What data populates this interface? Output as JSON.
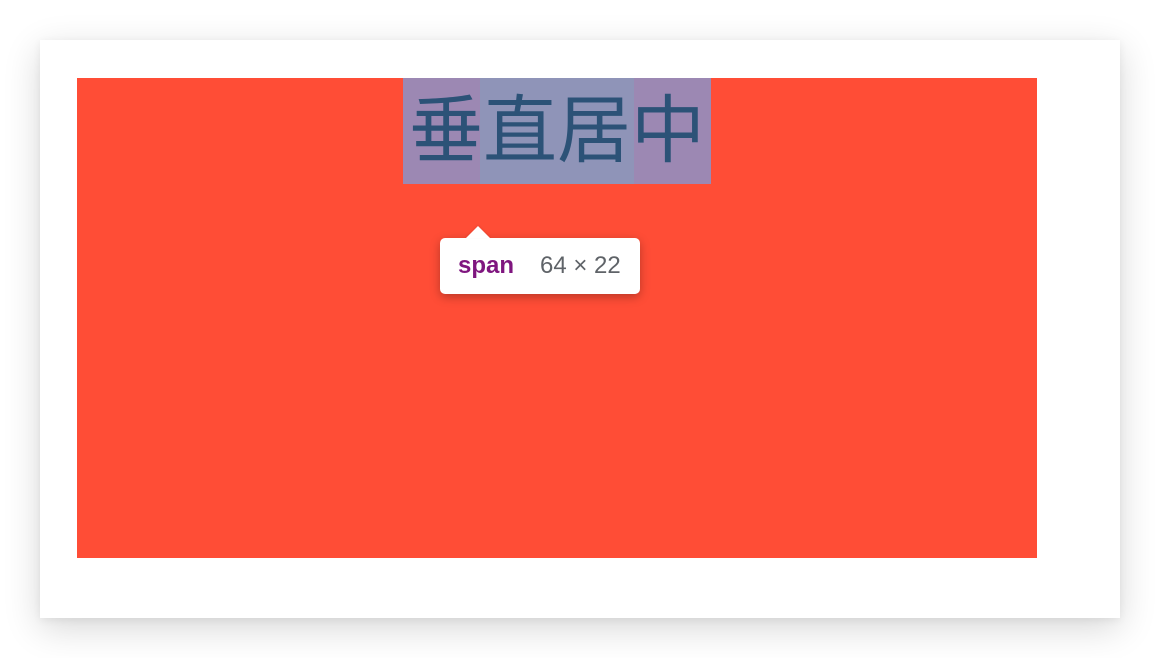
{
  "content": {
    "hero_text": "垂直居中"
  },
  "devtools_tooltip": {
    "tag": "span",
    "size": "64 × 22"
  },
  "colors": {
    "red_box": "#ff4d36",
    "text_color": "#2c5277",
    "tooltip_tag": "#7f167f"
  }
}
